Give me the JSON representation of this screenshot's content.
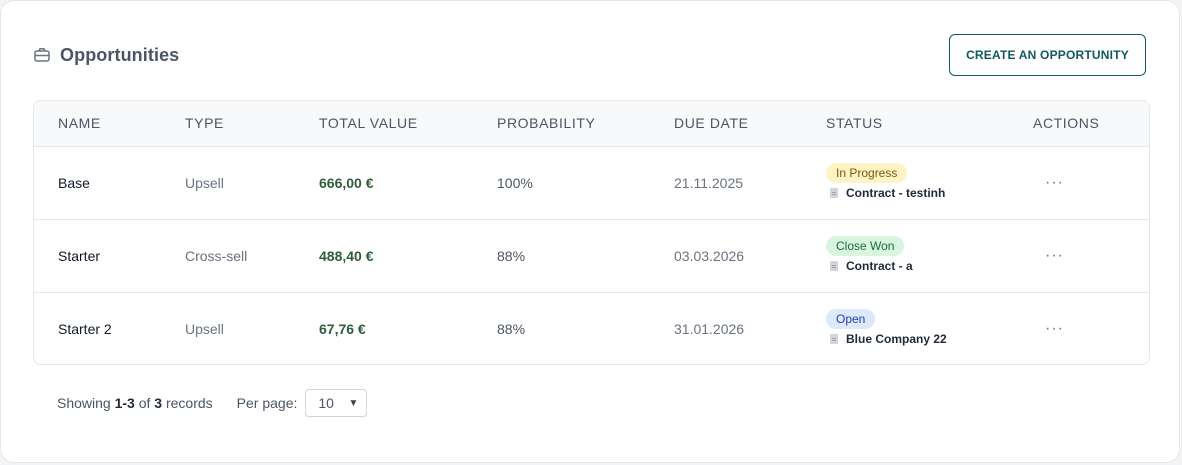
{
  "header": {
    "title": "Opportunities",
    "icon": "briefcase-icon",
    "create_button": "CREATE AN OPPORTUNITY"
  },
  "table": {
    "columns": [
      "NAME",
      "TYPE",
      "TOTAL VALUE",
      "PROBABILITY",
      "DUE DATE",
      "STATUS",
      "ACTIONS"
    ],
    "rows": [
      {
        "name": "Base",
        "type": "Upsell",
        "total_value": "666,00 €",
        "probability": "100%",
        "due_date": "21.11.2025",
        "status": "In Progress",
        "related": "Contract - testinh",
        "actions": "···"
      },
      {
        "name": "Starter",
        "type": "Cross-sell",
        "total_value": "488,40 €",
        "probability": "88%",
        "due_date": "03.03.2026",
        "status": "Close Won",
        "related": "Contract - a",
        "actions": "···"
      },
      {
        "name": "Starter 2",
        "type": "Upsell",
        "total_value": "67,76 €",
        "probability": "88%",
        "due_date": "31.01.2026",
        "status": "Open",
        "related": "Blue Company 22",
        "actions": "···"
      }
    ]
  },
  "footer": {
    "showing_prefix": "Showing",
    "range": "1-3",
    "of": "of",
    "total": "3",
    "records": "records",
    "per_page_label": "Per page:",
    "per_page_value": "10"
  },
  "colors": {
    "accent": "#0f5960",
    "value_text": "#2f5d3a",
    "in_progress_bg": "#fdf3c4",
    "close_won_bg": "#d7f5df",
    "open_bg": "#dde9fb"
  }
}
